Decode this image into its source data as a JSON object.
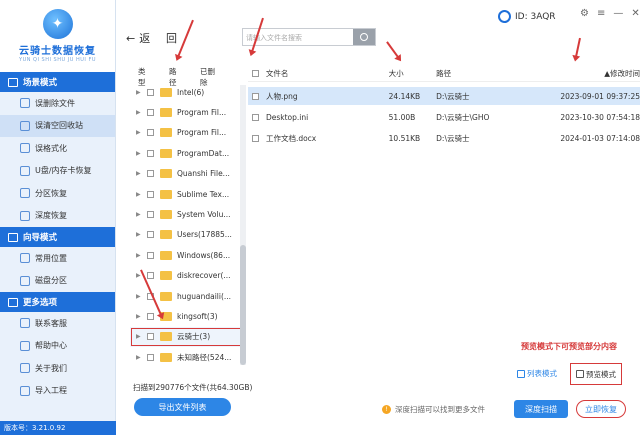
{
  "app": {
    "title": "云骑士数据恢复",
    "subtitle": "YUN QI SHI SHU JU HUI FU",
    "version": "版本号：3.21.0.92",
    "user_id": "ID: 3AQR"
  },
  "sidebar": {
    "sections": [
      {
        "title": "场景模式",
        "items": [
          "误删除文件",
          "误清空回收站",
          "误格式化",
          "U盘/内存卡恢复",
          "分区恢复",
          "深度恢复"
        ],
        "active_index": 1
      },
      {
        "title": "向导模式",
        "items": [
          "常用位置",
          "磁盘分区"
        ]
      },
      {
        "title": "更多选项",
        "items": [
          "联系客服",
          "帮助中心",
          "关于我们",
          "导入工程"
        ]
      }
    ]
  },
  "toolbar": {
    "back_label": "返",
    "home_label": "回",
    "search_placeholder": "请输入文件名搜索"
  },
  "tree": {
    "headers": [
      "类型",
      "路径",
      "已删除"
    ],
    "rows": [
      "Intel(6)",
      "Program Fil...",
      "Program Fil...",
      "ProgramDat...",
      "Quanshi File...",
      "Sublime Tex...",
      "System Volu...",
      "Users(17885...",
      "Windows(86...",
      "diskrecover(...",
      "huguandaili(...",
      "kingsoft(3)",
      "云骑士(3)",
      "未知路径(524..."
    ],
    "highlighted_index": 12
  },
  "files": {
    "headers": {
      "name": "文件名",
      "size": "大小",
      "path": "路径",
      "mtime": "修改时间"
    },
    "rows": [
      {
        "name": "人物.png",
        "size": "24.14KB",
        "path": "D:\\云骑士",
        "mtime": "2023-09-01 09:37:25"
      },
      {
        "name": "Desktop.ini",
        "size": "51.00B",
        "path": "D:\\云骑士\\GHO",
        "mtime": "2023-10-30 07:54:18"
      },
      {
        "name": "工作文档.docx",
        "size": "10.51KB",
        "path": "D:\\云骑士",
        "mtime": "2024-01-03 07:14:08"
      }
    ],
    "selected_index": 0
  },
  "scan_info": "扫描到290776个文件(共64.30GB)",
  "export_label": "导出文件列表",
  "annotation": "预览模式下可预览部分内容",
  "view": {
    "list_label": "列表模式",
    "preview_label": "预览模式"
  },
  "hint": "深度扫描可以找到更多文件",
  "buttons": {
    "deep_scan": "深度扫描",
    "recover_now": "立即恢复"
  },
  "colors": {
    "brand": "#1e6fd9",
    "button": "#2d86e6",
    "annotation": "#d63a3a",
    "folder": "#f4c145"
  }
}
